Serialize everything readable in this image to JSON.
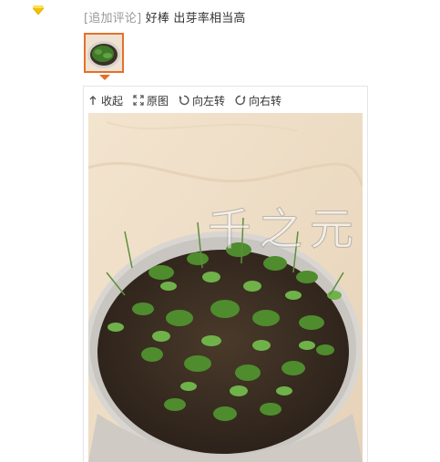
{
  "comment": {
    "tag": "[追加评论]",
    "text": "好棒 出芽率相当高"
  },
  "toolbar": {
    "collapse_label": "收起",
    "original_label": "原图",
    "rotate_left_label": "向左转",
    "rotate_right_label": "向右转"
  },
  "watermark": {
    "text": "千之元"
  },
  "icons": {
    "badge": "diamond-badge-icon",
    "collapse": "arrow-up-icon",
    "original": "expand-icon",
    "rotate_left": "rotate-left-icon",
    "rotate_right": "rotate-right-icon"
  },
  "colors": {
    "accent": "#e4702b",
    "tag_gray": "#999999",
    "badge_yellow": "#f2c200"
  }
}
